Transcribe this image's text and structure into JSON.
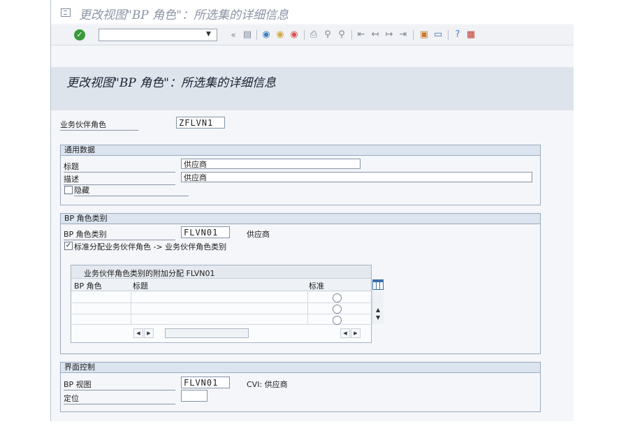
{
  "window": {
    "title": "更改视图\"BP 角色\"：所选集的详细信息"
  },
  "toolbar": {
    "command_value": "",
    "back_label": "«",
    "icons": [
      "save-icon",
      "back-icon",
      "exit-icon",
      "cancel-icon",
      "print-icon",
      "find-icon",
      "find-next-icon",
      "first-page-icon",
      "prev-page-icon",
      "next-page-icon",
      "last-page-icon",
      "new-session-icon",
      "shortcut-icon",
      "help-icon",
      "customize-icon"
    ]
  },
  "screen": {
    "title": "更改视图\"BP 角色\"：所选集的详细信息"
  },
  "bp_role": {
    "label": "业务伙伴角色",
    "value": "ZFLVN1"
  },
  "general": {
    "header": "通用数据",
    "title_label": "标题",
    "title_value": "供应商",
    "desc_label": "描述",
    "desc_value": "供应商",
    "hidden_label": "隐藏",
    "hidden_checked": false
  },
  "category": {
    "header": "BP 角色类别",
    "label": "BP 角色类别",
    "value": "FLVN01",
    "value_text": "供应商",
    "std_assign_label": "标准分配业务伙伴角色 -> 业务伙伴角色类别",
    "std_assign_checked": true
  },
  "assign_table": {
    "header": "业务伙伴角色类别的附加分配 FLVN01",
    "columns": [
      "BP 角色",
      "标题",
      "标准"
    ],
    "row_count": 3
  },
  "interface": {
    "header": "界面控制",
    "view_label": "BP 视图",
    "view_value": "FLVN01",
    "view_text": "CVI: 供应商",
    "position_label": "定位",
    "position_value": ""
  },
  "colors": {
    "accent": "#dbe4ef",
    "ok_green": "#3a9a3a",
    "cancel_red": "#d9534f"
  }
}
